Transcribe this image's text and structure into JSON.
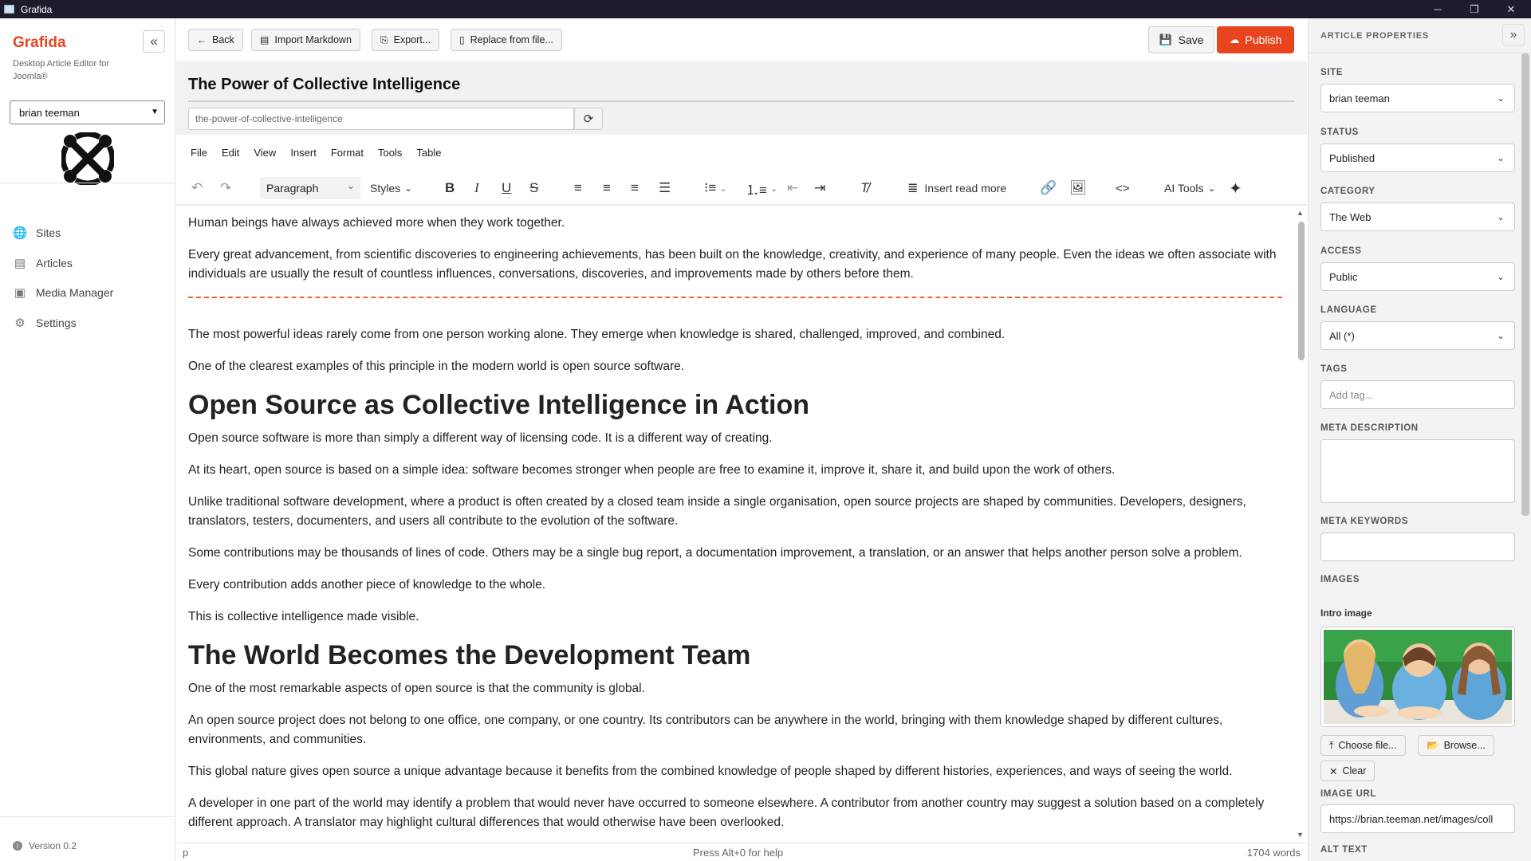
{
  "window": {
    "title": "Grafida",
    "min": "─",
    "restore": "❐",
    "close": "✕"
  },
  "sidebar": {
    "brand": "Grafida",
    "tagline": "Desktop Article Editor for Joomla®",
    "collapse_icon": "«",
    "site_select": "brian teeman",
    "nav": [
      {
        "label": "Sites",
        "icon": "globe-icon"
      },
      {
        "label": "Articles",
        "icon": "file-icon"
      },
      {
        "label": "Media Manager",
        "icon": "images-icon"
      },
      {
        "label": "Settings",
        "icon": "gear-icon"
      }
    ],
    "version": "Version 0.2"
  },
  "toolbar": {
    "back": "Back",
    "import_markdown": "Import Markdown",
    "export": "Export...",
    "replace": "Replace from file...",
    "save": "Save",
    "publish": "Publish"
  },
  "article": {
    "title": "The Power of Collective Intelligence",
    "alias": "the-power-of-collective-intelligence"
  },
  "menu": [
    "File",
    "Edit",
    "View",
    "Insert",
    "Format",
    "Tools",
    "Table"
  ],
  "editor_tools": {
    "block_format": "Paragraph",
    "styles": "Styles",
    "read_more": "Insert read more",
    "ai_tools": "AI Tools"
  },
  "content": {
    "p1": "Human beings have always achieved more when they work together.",
    "p2": "Every great advancement, from scientific discoveries to engineering achievements, has been built on the knowledge, creativity, and experience of many people. Even the ideas we often associate with individuals are usually the result of countless influences, conversations, discoveries, and improvements made by others before them.",
    "p3": "The most powerful ideas rarely come from one person working alone. They emerge when knowledge is shared, challenged, improved, and combined.",
    "p4": "One of the clearest examples of this principle in the modern world is open source software.",
    "h1": "Open Source as Collective Intelligence in Action",
    "p5": "Open source software is more than simply a different way of licensing code. It is a different way of creating.",
    "p6": "At its heart, open source is based on a simple idea: software becomes stronger when people are free to examine it, improve it, share it, and build upon the work of others.",
    "p7": "Unlike traditional software development, where a product is often created by a closed team inside a single organisation, open source projects are shaped by communities. Developers, designers, translators, testers, documenters, and users all contribute to the evolution of the software.",
    "p8": "Some contributions may be thousands of lines of code. Others may be a single bug report, a documentation improvement, a translation, or an answer that helps another person solve a problem.",
    "p9": "Every contribution adds another piece of knowledge to the whole.",
    "p10": "This is collective intelligence made visible.",
    "h2": "The World Becomes the Development Team",
    "p11": "One of the most remarkable aspects of open source is that the community is global.",
    "p12": "An open source project does not belong to one office, one company, or one country. Its contributors can be anywhere in the world, bringing with them knowledge shaped by different cultures, environments, and communities.",
    "p13": "This global nature gives open source a unique advantage because it benefits from the combined knowledge of people shaped by different histories, experiences, and ways of seeing the world.",
    "p14": "A developer in one part of the world may identify a problem that would never have occurred to someone elsewhere. A contributor from another country may suggest a solution based on a completely different approach. A translator may highlight cultural differences that would otherwise have been overlooked."
  },
  "status": {
    "path": "p",
    "help": "Press Alt+0 for help",
    "words": "1704 words"
  },
  "props": {
    "heading": "ARTICLE PROPERTIES",
    "collapse_icon": "»",
    "site_label": "SITE",
    "site": "brian teeman",
    "status_label": "STATUS",
    "status": "Published",
    "category_label": "CATEGORY",
    "category": "The Web",
    "access_label": "ACCESS",
    "access": "Public",
    "language_label": "LANGUAGE",
    "language": "All (*)",
    "tags_label": "TAGS",
    "tags_placeholder": "Add tag...",
    "meta_desc_label": "META DESCRIPTION",
    "meta_kw_label": "META KEYWORDS",
    "images_label": "IMAGES",
    "intro_image_label": "Intro image",
    "choose_file": "Choose file...",
    "browse": "Browse...",
    "clear": "Clear",
    "image_url_label": "IMAGE URL",
    "image_url": "https://brian.teeman.net/images/coll",
    "alt_text_label": "ALT TEXT"
  },
  "colors": {
    "accent": "#e8451f",
    "titlebar": "#1f1b2d"
  }
}
